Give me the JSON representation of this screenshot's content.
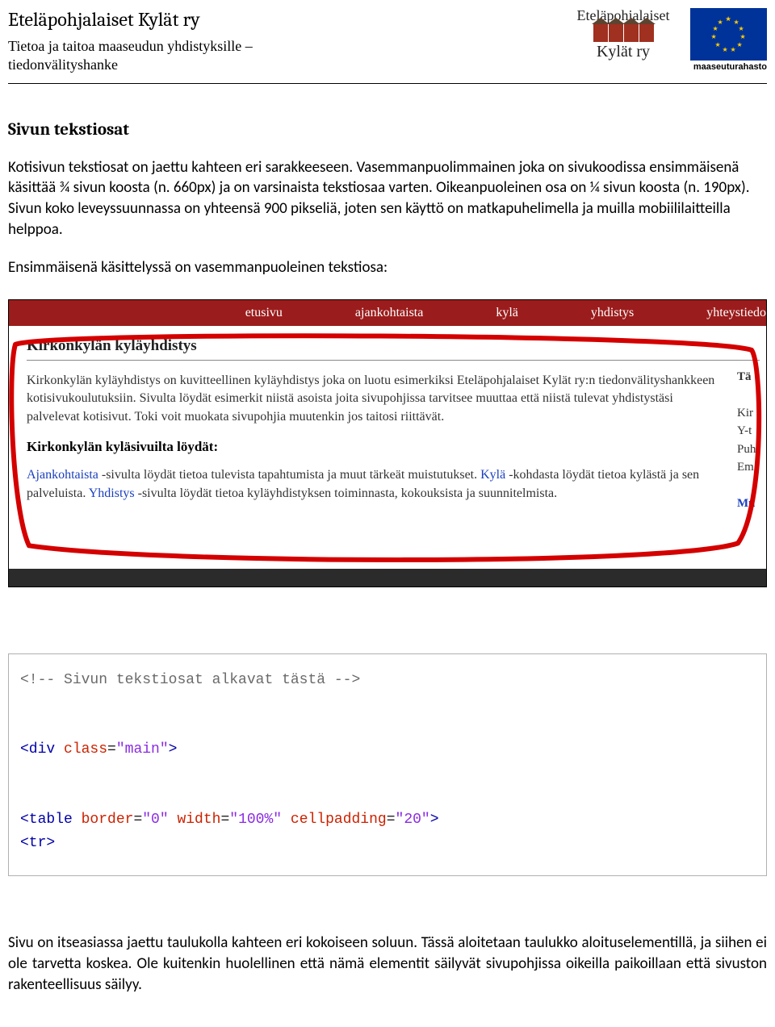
{
  "header": {
    "org_name": "Eteläpohjalaiset Kylät ry",
    "subtitle_line1": "Tietoa ja taitoa maaseudun yhdistyksille –",
    "subtitle_line2": "tiedonvälityshanke",
    "logo_ep_top": "Eteläpohjalaiset",
    "logo_ep_bottom": "Kylät ry",
    "maaseutu": "maaseuturahasto"
  },
  "content": {
    "section_title": "Sivun tekstiosat",
    "para1": "Kotisivun tekstiosat on jaettu kahteen eri sarakkeeseen. Vasemmanpuolimmainen joka on sivukoodissa ensimmäisenä käsittää ¾ sivun koosta (n. 660px) ja on varsinaista tekstiosaa varten. Oikeanpuoleinen osa on ¼ sivun koosta (n. 190px). Sivun koko leveyssuunnassa on yhteensä 900 pikseliä, joten sen käyttö on matkapuhelimella ja muilla mobiililaitteilla helppoa.",
    "para2": "Ensimmäisenä käsittelyssä on vasemmanpuoleinen tekstiosa:",
    "para3": "Sivu on itseasiassa jaettu taulukolla kahteen eri kokoiseen soluun. Tässä aloitetaan taulukko aloituselementillä, ja siihen ei ole tarvetta koskea. Ole kuitenkin huolellinen että nämä elementit säilyvät sivupohjissa oikeilla paikoillaan että sivuston rakenteellisuus säilyy."
  },
  "shot1": {
    "menu": {
      "etusivu": "etusivu",
      "ajankohtaista": "ajankohtaista",
      "kyla": "kylä",
      "yhdistys": "yhdistys",
      "yhteystiedot": "yhteystiedo"
    },
    "h1": "Kirkonkylän kyläyhdistys",
    "p1": "Kirkonkylän kyläyhdistys on kuvitteellinen kyläyhdistys joka on luotu esimerkiksi Eteläpohjalaiset Kylät ry:n tiedonvälityshankkeen kotisivukoulutuksiin. Sivulta löydät esimerkit niistä asoista joita sivupohjissa tarvitsee muuttaa että niistä tulevat yhdistystäsi palvelevat kotisivut. Toki voit muokata sivupohjia muutenkin jos taitosi riittävät.",
    "sub": "Kirkonkylän kyläsivuilta löydät:",
    "p2_a_link": "Ajankohtaista",
    "p2_a": " -sivulta löydät tietoa tulevista tapahtumista ja muut tärkeät muistutukset. ",
    "p2_b_link": "Kylä",
    "p2_b": " -kohdasta löydät tietoa kylästä ja sen palveluista. ",
    "p2_c_link": "Yhdistys",
    "p2_c": " -sivulta löydät tietoa kyläyhdistyksen toiminnasta, kokouksista ja suunnitelmista.",
    "side_t": "Tä",
    "side_l1": "Kir",
    "side_l2": "Y-t",
    "side_l3": "Puh",
    "side_l4": "Em",
    "side_mu": "Mu"
  },
  "shot2": {
    "comment_open": "<!--",
    "comment_text": " Sivun tekstiosat alkavat tästä ",
    "comment_close": "-->",
    "div_open": "<div",
    "class_attr": " class",
    "eq": "=",
    "class_val": "\"main\"",
    "div_close": ">",
    "table_open": "<table",
    "border_attr": " border",
    "border_val": "\"0\"",
    "width_attr": " width",
    "width_val": "\"100%\"",
    "cell_attr": " cellpadding",
    "cell_val": "\"20\"",
    "table_close": ">",
    "tr": "<tr>"
  }
}
